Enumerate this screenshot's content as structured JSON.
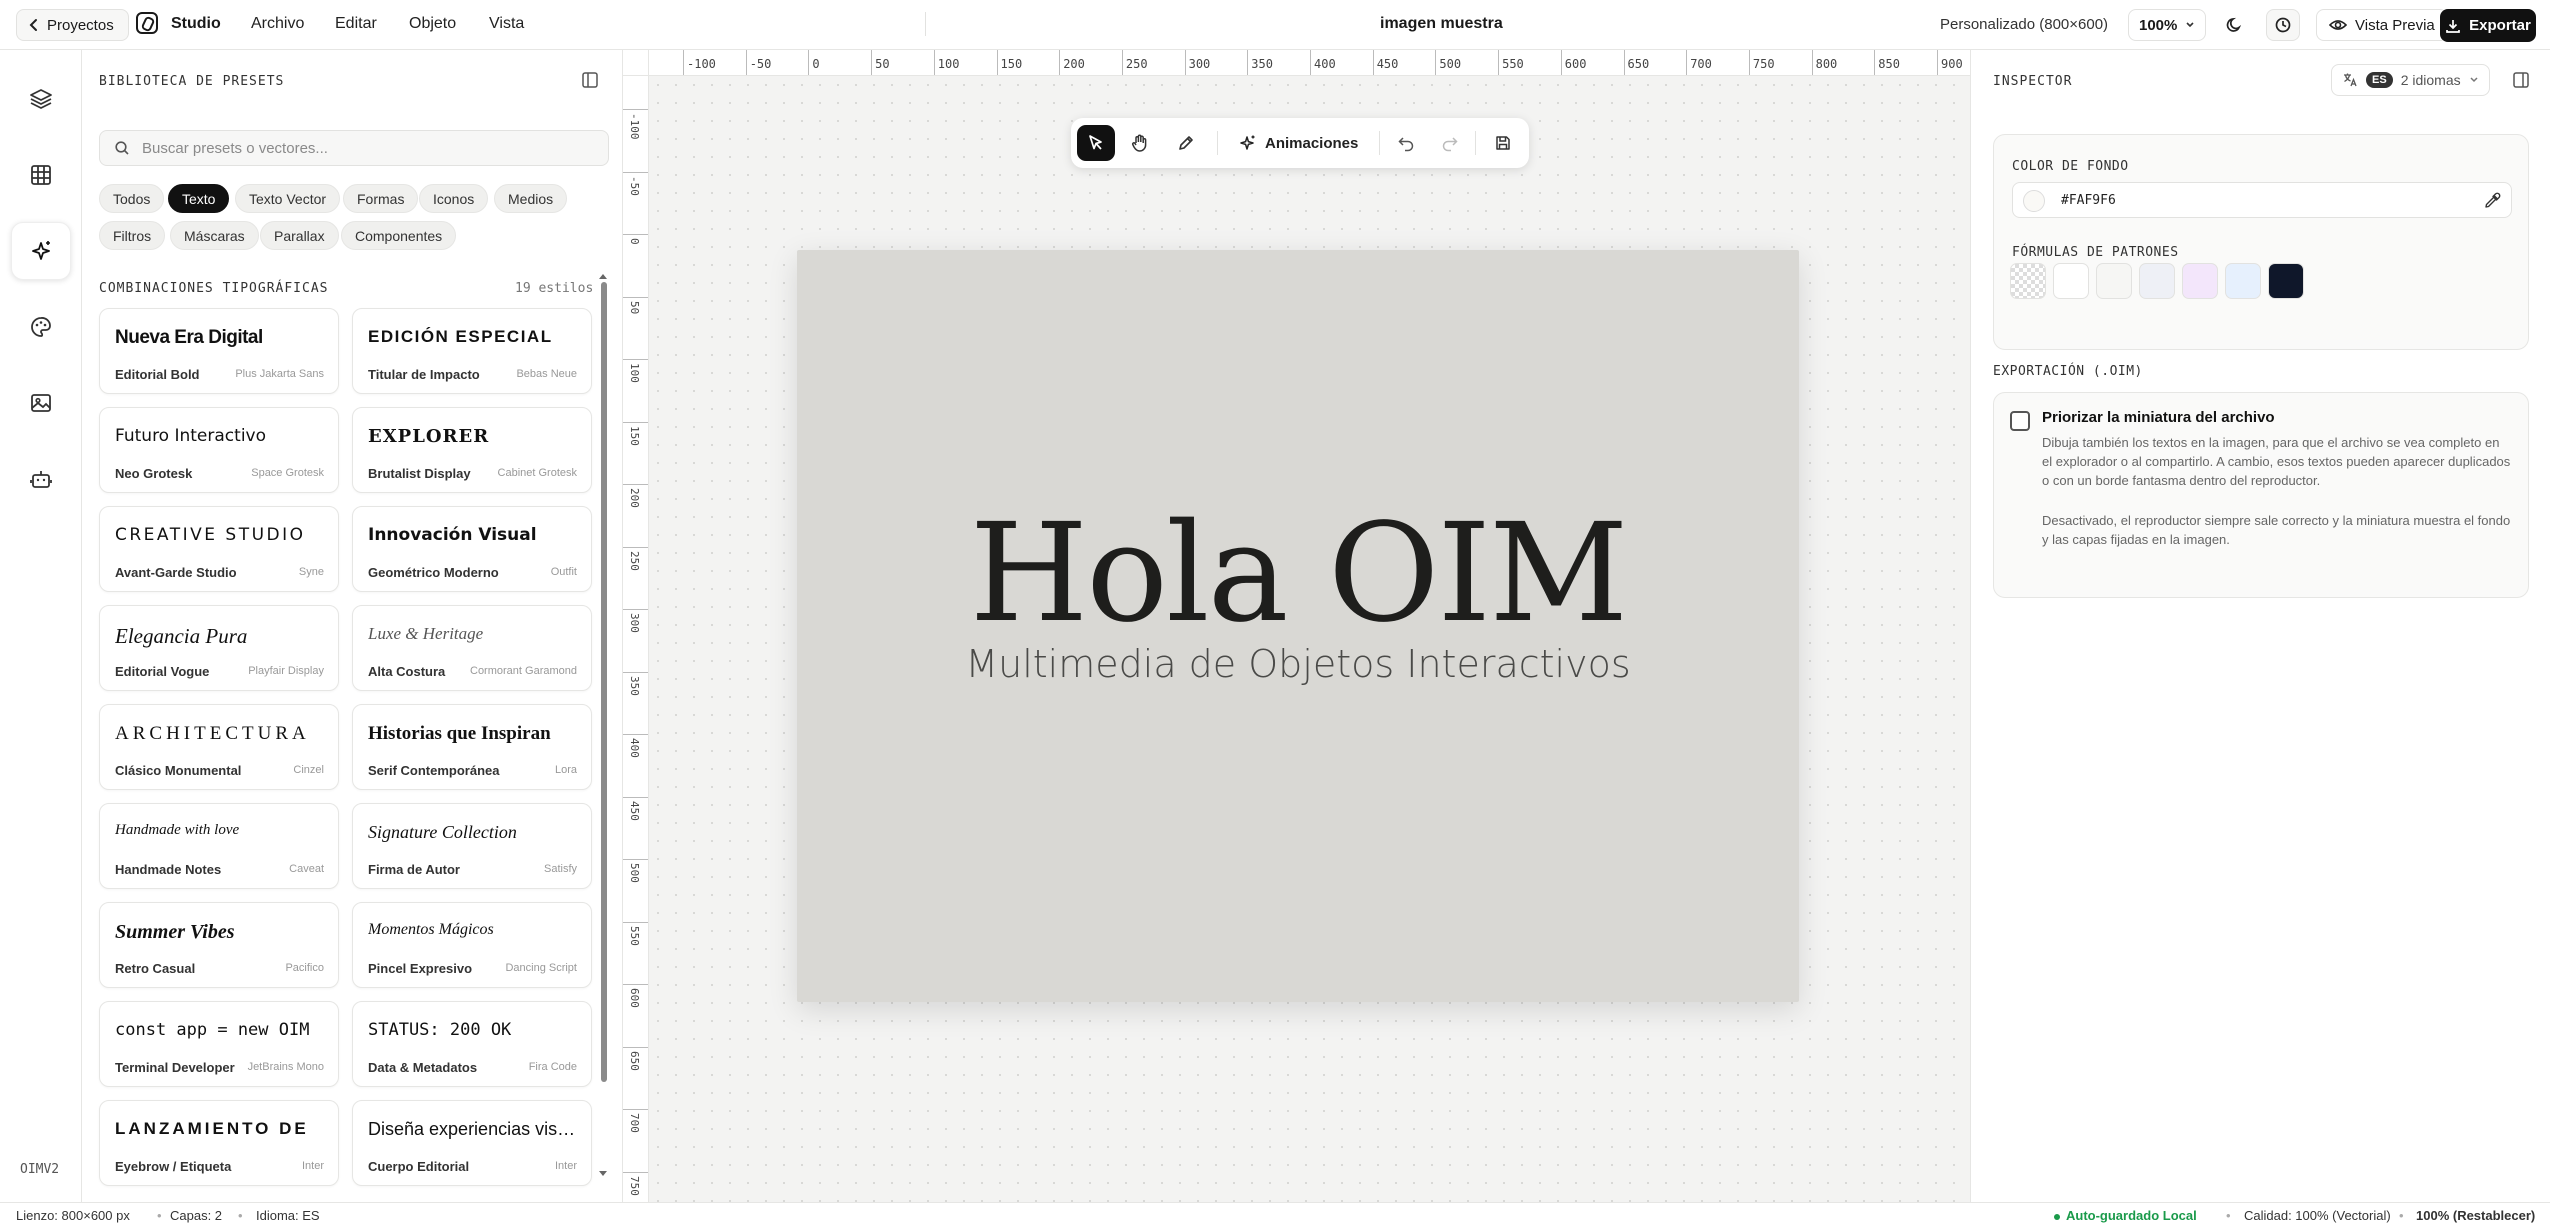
{
  "topbar": {
    "back_label": "Proyectos",
    "brand": "Studio",
    "menus": [
      "Archivo",
      "Editar",
      "Objeto",
      "Vista"
    ],
    "document_title": "imagen muestra",
    "canvas_size": "Personalizado (800×600)",
    "zoom": "100%",
    "preview_label": "Vista Previa",
    "export_label": "Exportar"
  },
  "rail": {
    "items": [
      "layers-icon",
      "grid-icon",
      "sparkles-icon",
      "palette-icon",
      "image-icon",
      "robot-icon"
    ],
    "active_index": 2,
    "version_label": "OIMV2"
  },
  "library": {
    "title": "BIBLIOTECA DE PRESETS",
    "search_placeholder": "Buscar presets o vectores...",
    "chips": [
      "Todos",
      "Texto",
      "Texto Vector",
      "Formas",
      "Iconos",
      "Medios",
      "Filtros",
      "Máscaras",
      "Parallax",
      "Componentes"
    ],
    "active_chip": "Texto",
    "section_title": "COMBINACIONES TIPOGRÁFICAS",
    "section_count": "19 estilos",
    "cards": [
      {
        "sample": "Nueva Era Digital",
        "name": "Editorial Bold",
        "font": "Plus Jakarta Sans"
      },
      {
        "sample": "EDICIÓN ESPECIAL",
        "name": "Titular de Impacto",
        "font": "Bebas Neue"
      },
      {
        "sample": "Futuro Interactivo",
        "name": "Neo Grotesk",
        "font": "Space Grotesk"
      },
      {
        "sample": "EXPLORER",
        "name": "Brutalist Display",
        "font": "Cabinet Grotesk"
      },
      {
        "sample": "CREATIVE STUDIO",
        "name": "Avant-Garde Studio",
        "font": "Syne"
      },
      {
        "sample": "Innovación Visual",
        "name": "Geométrico Moderno",
        "font": "Outfit"
      },
      {
        "sample": "Elegancia Pura",
        "name": "Editorial Vogue",
        "font": "Playfair Display"
      },
      {
        "sample": "Luxe & Heritage",
        "name": "Alta Costura",
        "font": "Cormorant Garamond"
      },
      {
        "sample": "ARCHITECTURA",
        "name": "Clásico Monumental",
        "font": "Cinzel"
      },
      {
        "sample": "Historias que Inspiran",
        "name": "Serif Contemporánea",
        "font": "Lora"
      },
      {
        "sample": "Handmade with love",
        "name": "Handmade Notes",
        "font": "Caveat"
      },
      {
        "sample": "Signature Collection",
        "name": "Firma de Autor",
        "font": "Satisfy"
      },
      {
        "sample": "Summer Vibes",
        "name": "Retro Casual",
        "font": "Pacifico"
      },
      {
        "sample": "Momentos Mágicos",
        "name": "Pincel Expresivo",
        "font": "Dancing Script"
      },
      {
        "sample": "const app = new OIM",
        "name": "Terminal Developer",
        "font": "JetBrains Mono"
      },
      {
        "sample": "STATUS: 200 OK",
        "name": "Data & Metadatos",
        "font": "Fira Code"
      },
      {
        "sample": "LANZAMIENTO DE",
        "name": "Eyebrow / Etiqueta",
        "font": "Inter"
      },
      {
        "sample": "Diseña experiencias visuales",
        "name": "Cuerpo Editorial",
        "font": "Inter"
      }
    ]
  },
  "rulers": {
    "top": [
      "-100",
      "-50",
      "0",
      "50",
      "100",
      "150",
      "200",
      "250",
      "300",
      "350",
      "400",
      "450",
      "500",
      "550",
      "600",
      "650",
      "700",
      "750",
      "800",
      "850",
      "900"
    ],
    "left": [
      "-100",
      "-50",
      "0",
      "50",
      "100",
      "150",
      "200",
      "250",
      "300",
      "350",
      "400",
      "450",
      "500",
      "550",
      "600",
      "650",
      "700",
      "750"
    ]
  },
  "toolbar": {
    "tools": [
      "select-icon",
      "hand-icon",
      "pen-icon"
    ],
    "animations_label": "Animaciones"
  },
  "artboard": {
    "title": "Hola OIM",
    "subtitle": "Multimedia de Objetos Interactivos"
  },
  "inspector": {
    "title": "INSPECTOR",
    "lang_code": "ES",
    "lang_label": "2 idiomas",
    "bg_label": "COLOR DE FONDO",
    "bg_value": "#FAF9F6",
    "patterns_label": "FÓRMULAS DE PATRONES",
    "pattern_colors": [
      "#ffffff",
      "#f6f6f4",
      "#eef0f6",
      "#f3e6fb",
      "#e6f0fd",
      "#0f172a"
    ],
    "export_section": "EXPORTACIÓN (.OIM)",
    "option_title": "Priorizar la miniatura del archivo",
    "option_desc1": "Dibuja también los textos en la imagen, para que el archivo se vea completo en el explorador o al compartirlo. A cambio, esos textos pueden aparecer duplicados o con un borde fantasma dentro del reproductor.",
    "option_desc2": "Desactivado, el reproductor siempre sale correcto y la miniatura muestra el fondo y las capas fijadas en la imagen."
  },
  "status": {
    "canvas": "Lienzo: 800×600 px",
    "layers": "Capas: 2",
    "language": "Idioma: ES",
    "autosave": "Auto-guardado Local",
    "quality": "Calidad: 100% (Vectorial)",
    "zoom": "100% (Restablecer)"
  },
  "colors": {
    "accent": "#111111",
    "autosave": "#1a9a4a",
    "artboard_bg": "#d9d8d4"
  }
}
